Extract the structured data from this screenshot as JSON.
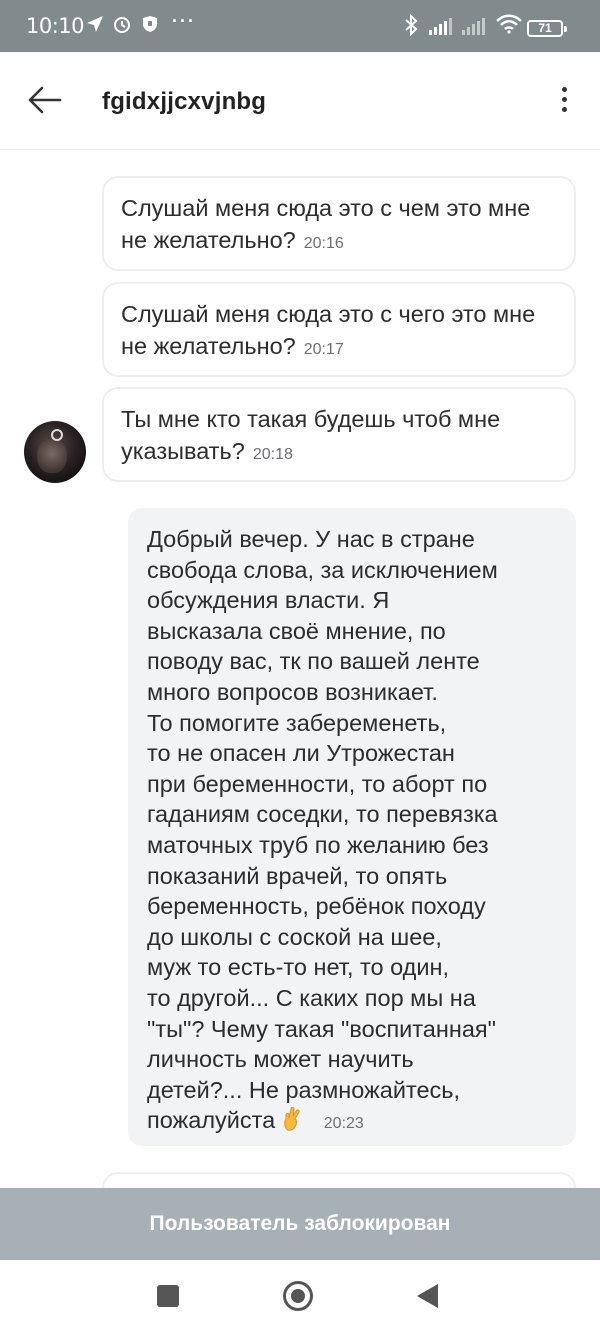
{
  "status_bar": {
    "time": "10:10",
    "battery": "71",
    "icons": [
      "navigation-icon",
      "alarm-icon",
      "shield-icon",
      "more-dots-icon",
      "bluetooth-icon",
      "signal-icon",
      "signal-icon",
      "wifi-icon",
      "battery-icon"
    ]
  },
  "header": {
    "title": "fgidxjjcxvjnbg"
  },
  "messages": [
    {
      "text": "Слушай меня сюда это с чем это мне не желательно?",
      "time": "20:16"
    },
    {
      "text": "Слушай меня сюда это с чего это мне не желательно?",
      "time": "20:17"
    },
    {
      "text": "Ты мне кто такая будешь чтоб мне указывать?",
      "time": "20:18"
    },
    {
      "lines": [
        "Добрый вечер. У нас в стране",
        "свобода слова, за исключением",
        "обсуждения власти. Я",
        "высказала своё мнение, по",
        "поводу вас, тк по вашей ленте",
        "много вопросов возникает.",
        "То помогите забеременеть,",
        "то не опасен ли Утрожестан",
        "при беременности, то аборт по",
        "гаданиям соседки, то перевязка",
        "маточных труб по желанию без",
        "показаний врачей, то опять",
        "беременность, ребёнок походу",
        "до школы с соской на шее,",
        "муж то есть-то нет, то один,",
        "то другой... С каких пор мы на",
        "\"ты\"? Чему такая \"воспитанная\"",
        "личность может научить",
        "детей?... Не размножайтесь,",
        "пожалуйста"
      ],
      "emoji": "crossed-fingers-emoji",
      "time": "20:23"
    }
  ],
  "blocked_banner": "Пользователь заблокирован",
  "colors": {
    "status_bar": "#818a8d",
    "blocked_bar": "#a7b0b4",
    "outgoing_bubble_bg": "#f2f3f5",
    "bubble_border": "#eceef0",
    "emoji": "#f6b93b"
  }
}
